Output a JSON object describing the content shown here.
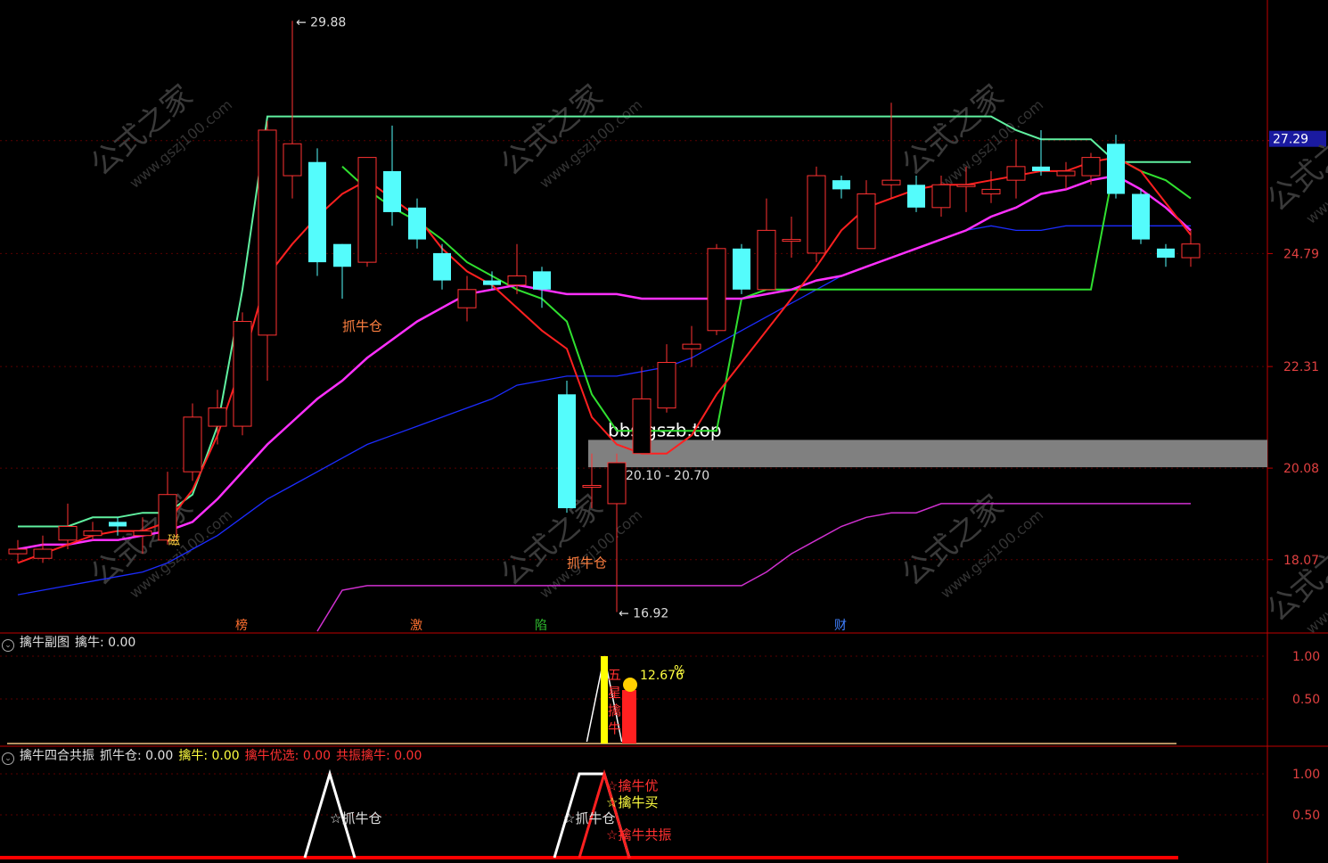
{
  "colors": {
    "background": "#000000",
    "up": "#ff3232",
    "down": "#54fcfc",
    "ma_short": "#ff2020",
    "ma_mid": "#ff30ff",
    "ma_long": "#1c2cff",
    "band_upper": "#60f0a0",
    "band_mid": "#30e030",
    "band_low": "#d030d0",
    "ybar": "#ffff00",
    "axis": "#c00000",
    "zone": "#808080"
  },
  "watermark": {
    "cn": "公式之家",
    "url": "www.gszj100.com"
  },
  "watermark_bbs": "bbs.gszb.top",
  "price_axis": {
    "ticks": [
      "27.27",
      "24.79",
      "22.31",
      "20.08",
      "18.07"
    ],
    "current": "27.29"
  },
  "annotations": {
    "high": "29.88",
    "low": "16.92",
    "range": "20.10 - 20.70",
    "zhua_niu_cang": "抓牛仓",
    "low_tag": "磁"
  },
  "event_markers": [
    "榜",
    "激",
    "陷",
    "财"
  ],
  "panel2": {
    "name": "擒牛副图",
    "field": "擒牛: 0.00",
    "axis": [
      "1.00",
      "0.50"
    ],
    "pct": "12.676",
    "pct_unit": "%",
    "vertical_text": [
      "五",
      "星",
      "擒",
      "牛"
    ]
  },
  "panel3": {
    "name": "擒牛四合共振",
    "fields": [
      {
        "text": "抓牛仓: 0.00",
        "color": "#e0e0e0"
      },
      {
        "text": "擒牛: 0.00",
        "color": "#ffff40"
      },
      {
        "text": "擒牛优选: 0.00",
        "color": "#ff3030"
      },
      {
        "text": "共振擒牛: 0.00",
        "color": "#ff3030"
      }
    ],
    "axis": [
      "1.00",
      "0.50"
    ],
    "labels": [
      "☆抓牛仓",
      "☆擒牛优",
      "☆擒牛买",
      "☆抓牛仓",
      "☆擒牛共振"
    ]
  },
  "chart_data": {
    "type": "candlestick",
    "y_range": [
      16.5,
      30.2
    ],
    "candles": [
      {
        "o": 18.2,
        "c": 18.3,
        "h": 18.5,
        "l": 18.0
      },
      {
        "o": 18.1,
        "c": 18.3,
        "h": 18.6,
        "l": 18.0
      },
      {
        "o": 18.5,
        "c": 18.8,
        "h": 19.3,
        "l": 18.3
      },
      {
        "o": 18.6,
        "c": 18.7,
        "h": 18.9,
        "l": 18.5
      },
      {
        "o": 18.9,
        "c": 18.8,
        "h": 19.0,
        "l": 18.6
      },
      {
        "o": 18.6,
        "c": 18.7,
        "h": 19.0,
        "l": 18.2
      },
      {
        "o": 18.5,
        "c": 19.5,
        "h": 20.0,
        "l": 18.4
      },
      {
        "o": 20.0,
        "c": 21.2,
        "h": 21.5,
        "l": 19.8
      },
      {
        "o": 21.0,
        "c": 21.4,
        "h": 21.8,
        "l": 20.6
      },
      {
        "o": 21.0,
        "c": 23.3,
        "h": 23.5,
        "l": 20.8
      },
      {
        "o": 23.0,
        "c": 27.5,
        "h": 27.7,
        "l": 22.0
      },
      {
        "o": 26.5,
        "c": 27.2,
        "h": 29.9,
        "l": 26.0
      },
      {
        "o": 26.8,
        "c": 24.6,
        "h": 27.1,
        "l": 24.3
      },
      {
        "o": 25.0,
        "c": 24.5,
        "h": 25.0,
        "l": 23.8
      },
      {
        "o": 24.6,
        "c": 26.9,
        "h": 26.9,
        "l": 24.5
      },
      {
        "o": 26.6,
        "c": 25.7,
        "h": 27.6,
        "l": 25.4
      },
      {
        "o": 25.8,
        "c": 25.1,
        "h": 26.0,
        "l": 24.9
      },
      {
        "o": 24.8,
        "c": 24.2,
        "h": 25.0,
        "l": 24.0
      },
      {
        "o": 23.6,
        "c": 24.0,
        "h": 24.3,
        "l": 23.3
      },
      {
        "o": 24.2,
        "c": 24.1,
        "h": 24.4,
        "l": 24.0
      },
      {
        "o": 24.1,
        "c": 24.3,
        "h": 25.0,
        "l": 23.9
      },
      {
        "o": 24.4,
        "c": 24.0,
        "h": 24.5,
        "l": 23.6
      },
      {
        "o": 21.7,
        "c": 19.2,
        "h": 22.0,
        "l": 19.1
      },
      {
        "o": 19.7,
        "c": 19.7,
        "h": 20.4,
        "l": 19.2
      },
      {
        "o": 19.3,
        "c": 20.2,
        "h": 20.4,
        "l": 16.92
      },
      {
        "o": 20.4,
        "c": 21.6,
        "h": 22.3,
        "l": 20.4
      },
      {
        "o": 21.4,
        "c": 22.4,
        "h": 22.8,
        "l": 21.3
      },
      {
        "o": 22.7,
        "c": 22.8,
        "h": 23.2,
        "l": 22.3
      },
      {
        "o": 23.1,
        "c": 24.9,
        "h": 25.0,
        "l": 23.0
      },
      {
        "o": 24.9,
        "c": 24.0,
        "h": 25.0,
        "l": 23.9
      },
      {
        "o": 24.0,
        "c": 25.3,
        "h": 26.0,
        "l": 24.0
      },
      {
        "o": 25.1,
        "c": 25.1,
        "h": 25.6,
        "l": 24.7
      },
      {
        "o": 24.8,
        "c": 26.5,
        "h": 26.7,
        "l": 24.6
      },
      {
        "o": 26.4,
        "c": 26.2,
        "h": 26.5,
        "l": 26.0
      },
      {
        "o": 24.9,
        "c": 26.1,
        "h": 26.4,
        "l": 24.9
      },
      {
        "o": 26.3,
        "c": 26.4,
        "h": 28.1,
        "l": 26.0
      },
      {
        "o": 26.3,
        "c": 25.8,
        "h": 26.5,
        "l": 25.7
      },
      {
        "o": 25.8,
        "c": 26.3,
        "h": 26.5,
        "l": 25.6
      },
      {
        "o": 26.3,
        "c": 26.3,
        "h": 26.7,
        "l": 25.7
      },
      {
        "o": 26.1,
        "c": 26.2,
        "h": 26.6,
        "l": 25.9
      },
      {
        "o": 26.4,
        "c": 26.7,
        "h": 27.3,
        "l": 26.0
      },
      {
        "o": 26.7,
        "c": 26.6,
        "h": 27.5,
        "l": 26.5
      },
      {
        "o": 26.5,
        "c": 26.6,
        "h": 26.8,
        "l": 26.2
      },
      {
        "o": 26.5,
        "c": 26.9,
        "h": 27.0,
        "l": 26.3
      },
      {
        "o": 27.2,
        "c": 26.1,
        "h": 27.4,
        "l": 26.0
      },
      {
        "o": 26.1,
        "c": 25.1,
        "h": 26.2,
        "l": 25.0
      },
      {
        "o": 24.9,
        "c": 24.7,
        "h": 25.0,
        "l": 24.5
      },
      {
        "o": 24.7,
        "c": 25.0,
        "h": 25.3,
        "l": 24.5
      }
    ],
    "ma_short": [
      18.0,
      18.2,
      18.4,
      18.6,
      18.7,
      18.7,
      18.9,
      19.6,
      20.8,
      22.4,
      24.3,
      25.0,
      25.6,
      26.1,
      26.4,
      26.0,
      25.6,
      24.9,
      24.4,
      24.1,
      23.6,
      23.1,
      22.7,
      21.2,
      20.6,
      20.4,
      20.4,
      20.8,
      21.7,
      22.4,
      23.1,
      23.8,
      24.5,
      25.3,
      25.8,
      26.0,
      26.2,
      26.3,
      26.3,
      26.4,
      26.5,
      26.6,
      26.6,
      26.8,
      26.9,
      26.6,
      25.9,
      25.2
    ],
    "ma_mid": [
      18.3,
      18.4,
      18.4,
      18.5,
      18.5,
      18.6,
      18.7,
      18.9,
      19.4,
      20.0,
      20.6,
      21.1,
      21.6,
      22.0,
      22.5,
      22.9,
      23.3,
      23.6,
      23.9,
      24.0,
      24.1,
      24.0,
      23.9,
      23.9,
      23.9,
      23.8,
      23.8,
      23.8,
      23.8,
      23.8,
      23.9,
      24.0,
      24.2,
      24.3,
      24.5,
      24.7,
      24.9,
      25.1,
      25.3,
      25.6,
      25.8,
      26.1,
      26.2,
      26.4,
      26.5,
      26.2,
      25.8,
      25.3
    ],
    "ma_long": [
      17.3,
      17.4,
      17.5,
      17.6,
      17.7,
      17.8,
      18.0,
      18.3,
      18.6,
      19.0,
      19.4,
      19.7,
      20.0,
      20.3,
      20.6,
      20.8,
      21.0,
      21.2,
      21.4,
      21.6,
      21.9,
      22.0,
      22.1,
      22.1,
      22.1,
      22.2,
      22.3,
      22.5,
      22.8,
      23.1,
      23.4,
      23.7,
      24.0,
      24.3,
      24.5,
      24.7,
      24.9,
      25.1,
      25.3,
      25.4,
      25.3,
      25.3,
      25.4,
      25.4,
      25.4,
      25.4,
      25.4,
      25.4
    ],
    "band_upper": [
      18.8,
      18.8,
      18.8,
      19.0,
      19.0,
      19.1,
      19.1,
      19.5,
      21.0,
      24.0,
      27.8,
      27.8,
      27.8,
      27.8,
      27.8,
      27.8,
      27.8,
      27.8,
      27.8,
      27.8,
      27.8,
      27.8,
      27.8,
      27.8,
      27.8,
      27.8,
      27.8,
      27.8,
      27.8,
      27.8,
      27.8,
      27.8,
      27.8,
      27.8,
      27.8,
      27.8,
      27.8,
      27.8,
      27.8,
      27.8,
      27.5,
      27.3,
      27.3,
      27.3,
      26.8,
      26.8,
      26.8,
      26.8
    ],
    "band_mid": [
      null,
      null,
      null,
      null,
      null,
      null,
      null,
      null,
      null,
      null,
      null,
      null,
      null,
      26.7,
      26.2,
      25.8,
      25.5,
      25.1,
      24.6,
      24.3,
      24.0,
      23.8,
      23.3,
      21.7,
      20.9,
      20.9,
      20.9,
      20.9,
      20.9,
      23.8,
      24.0,
      24.0,
      24.0,
      24.0,
      24.0,
      24.0,
      24.0,
      24.0,
      24.0,
      24.0,
      24.0,
      24.0,
      24.0,
      24.0,
      26.9,
      26.6,
      26.4,
      26.0
    ],
    "band_low": [
      null,
      null,
      null,
      null,
      null,
      null,
      null,
      null,
      null,
      null,
      null,
      null,
      16.5,
      17.4,
      17.5,
      17.5,
      17.5,
      17.5,
      17.5,
      17.5,
      17.5,
      17.5,
      17.5,
      17.5,
      17.5,
      17.5,
      17.5,
      17.5,
      17.5,
      17.5,
      17.8,
      18.2,
      18.5,
      18.8,
      19.0,
      19.1,
      19.1,
      19.3,
      19.3,
      19.3,
      19.3,
      19.3,
      19.3,
      19.3,
      19.3,
      19.3,
      19.3,
      19.3
    ],
    "panel2_series": {
      "x_index": [
        22.8,
        23.5,
        24.2
      ],
      "values": [
        0,
        1,
        0
      ]
    },
    "panel3_series": {
      "white": [
        {
          "x": 12.5,
          "y": 1
        },
        {
          "x": 22.5,
          "y": 1
        },
        {
          "x": 23.5,
          "y": 1
        }
      ],
      "red": [
        {
          "x": 23.5,
          "y": 1
        }
      ]
    }
  }
}
